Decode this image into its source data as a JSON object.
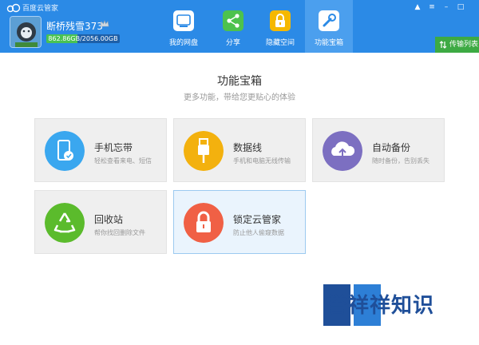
{
  "app": {
    "title": "百度云管家"
  },
  "user": {
    "name": "断桥残雪373",
    "quota": "862.86GB/2056.00GB",
    "quota_fraction": 0.42
  },
  "tabs": [
    {
      "label": "我的网盘",
      "icon": "cloud-drive-icon",
      "color": "#ffffff"
    },
    {
      "label": "分享",
      "icon": "share-icon",
      "color": "#4dc24d"
    },
    {
      "label": "隐藏空间",
      "icon": "lock-icon",
      "color": "#f5b800"
    },
    {
      "label": "功能宝箱",
      "icon": "toolbox-icon",
      "color": "#ffffff"
    }
  ],
  "active_tab": "功能宝箱",
  "transfer": {
    "label": "传输列表"
  },
  "page": {
    "title": "功能宝箱",
    "subtitle": "更多功能，带给您更贴心的体验"
  },
  "tools": [
    {
      "title": "手机忘带",
      "desc": "轻松查看来电、短信",
      "icon": "phone-icon",
      "color": "#3aa7ef"
    },
    {
      "title": "数据线",
      "desc": "手机和电脑无线传输",
      "icon": "usb-cable-icon",
      "color": "#f3b10e"
    },
    {
      "title": "自动备份",
      "desc": "随时备份，告别丢失",
      "icon": "cloud-upload-icon",
      "color": "#7c6fc1"
    },
    {
      "title": "回收站",
      "desc": "帮你找回删除文件",
      "icon": "recycle-icon",
      "color": "#5bbb2c"
    },
    {
      "title": "锁定云管家",
      "desc": "防止他人偷窥数据",
      "icon": "padlock-icon",
      "color": "#f06045"
    }
  ],
  "watermark": {
    "text": "誉祥祥知识"
  },
  "colors": {
    "header": "#2b8ae6",
    "tab_active": "#4b9fee",
    "transfer": "#3daa43"
  }
}
